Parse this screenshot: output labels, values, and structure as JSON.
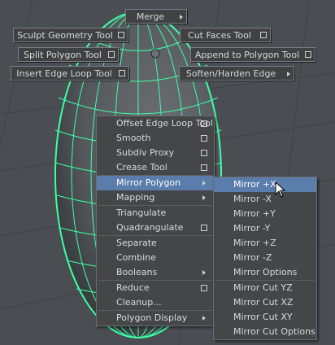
{
  "marking_menu": {
    "merge": "Merge",
    "sculpt_geometry_tool": "Sculpt Geometry Tool",
    "cut_faces_tool": "Cut Faces Tool",
    "split_polygon_tool": "Split Polygon Tool",
    "append_to_polygon_tool": "Append to Polygon Tool",
    "insert_edge_loop_tool": "Insert Edge Loop Tool",
    "soften_harden_edge": "Soften/Harden Edge"
  },
  "context_menu": {
    "items": [
      {
        "label": "Offset Edge Loop Tool",
        "option_box": true
      },
      {
        "label": "Smooth",
        "option_box": true
      },
      {
        "label": "Subdiv Proxy",
        "option_box": true
      },
      {
        "label": "Crease Tool",
        "option_box": true
      },
      {
        "label": "Mirror Polygon",
        "submenu": true,
        "highlighted": true
      },
      {
        "label": "Mapping",
        "submenu": true
      },
      {
        "label": "Triangulate"
      },
      {
        "label": "Quadrangulate",
        "option_box": true
      },
      {
        "label": "Separate"
      },
      {
        "label": "Combine"
      },
      {
        "label": "Booleans",
        "submenu": true
      },
      {
        "label": "Reduce",
        "option_box": true
      },
      {
        "label": "Cleanup..."
      },
      {
        "label": "Polygon Display",
        "submenu": true
      }
    ]
  },
  "mirror_submenu": {
    "items": [
      {
        "label": "Mirror +X",
        "highlighted": true
      },
      {
        "label": "Mirror -X"
      },
      {
        "label": "Mirror +Y"
      },
      {
        "label": "Mirror -Y"
      },
      {
        "label": "Mirror +Z"
      },
      {
        "label": "Mirror -Z"
      },
      {
        "label": "Mirror Options"
      },
      {
        "label": "Mirror Cut YZ"
      },
      {
        "label": "Mirror Cut XZ"
      },
      {
        "label": "Mirror Cut XY"
      },
      {
        "label": "Mirror Cut Options"
      }
    ]
  },
  "colors": {
    "viewport_bg": "#4a4e53",
    "wireframe": "#3dffa4",
    "highlight": "#5a7dac"
  }
}
